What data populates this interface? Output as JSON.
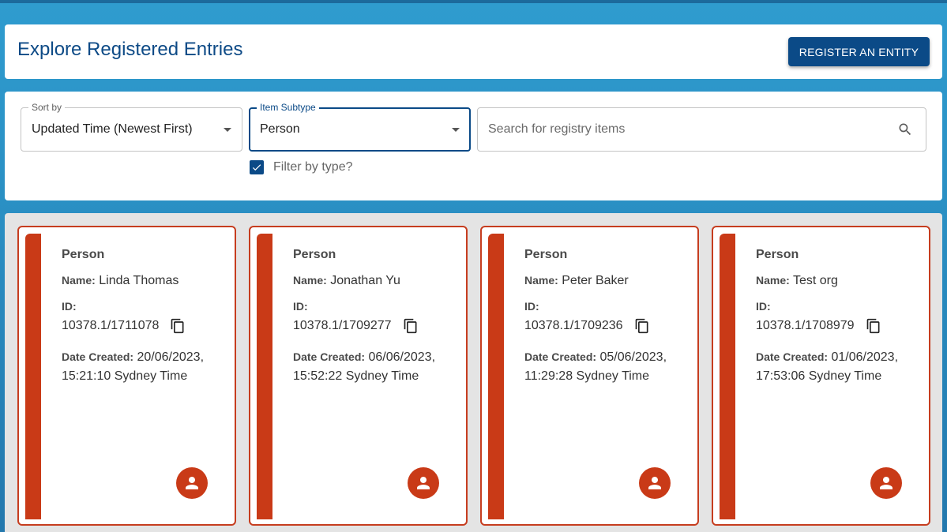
{
  "header": {
    "title": "Explore Registered Entries",
    "register_label": "REGISTER AN ENTITY"
  },
  "filters": {
    "sort": {
      "label": "Sort by",
      "value": "Updated Time (Newest First)"
    },
    "subtype": {
      "label": "Item Subtype",
      "value": "Person"
    },
    "search": {
      "placeholder": "Search for registry items"
    },
    "filter_by_type": {
      "label": "Filter by type?",
      "checked": true
    }
  },
  "labels": {
    "name": "Name:",
    "id": "ID:",
    "date_created": "Date Created:"
  },
  "entries": [
    {
      "type": "Person",
      "name": "Linda Thomas",
      "id": "10378.1/1711078",
      "date": "20/06/2023,",
      "time": "15:21:10 Sydney Time"
    },
    {
      "type": "Person",
      "name": "Jonathan Yu",
      "id": "10378.1/1709277",
      "date": "06/06/2023,",
      "time": "15:52:22 Sydney Time"
    },
    {
      "type": "Person",
      "name": "Peter Baker",
      "id": "10378.1/1709236",
      "date": "05/06/2023,",
      "time": "11:29:28 Sydney Time"
    },
    {
      "type": "Person",
      "name": "Test org",
      "id": "10378.1/1708979",
      "date": "01/06/2023,",
      "time": "17:53:06 Sydney Time"
    }
  ],
  "colors": {
    "primary": "#0b4a87",
    "accent": "#c93a17",
    "background": "#2a8fc3"
  }
}
